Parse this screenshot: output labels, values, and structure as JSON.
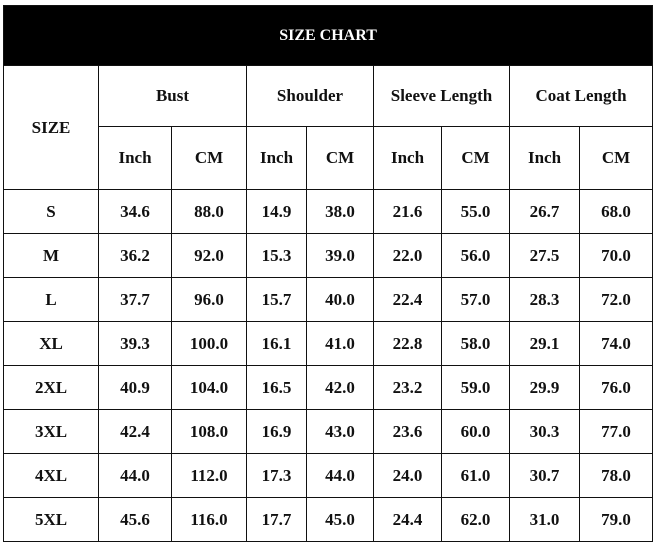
{
  "title": "SIZE CHART",
  "size_header": "SIZE",
  "groups": [
    "Bust",
    "Shoulder",
    "Sleeve Length",
    "Coat Length"
  ],
  "units": [
    "Inch",
    "CM"
  ],
  "rows": [
    [
      "S",
      "34.6",
      "88.0",
      "14.9",
      "38.0",
      "21.6",
      "55.0",
      "26.7",
      "68.0"
    ],
    [
      "M",
      "36.2",
      "92.0",
      "15.3",
      "39.0",
      "22.0",
      "56.0",
      "27.5",
      "70.0"
    ],
    [
      "L",
      "37.7",
      "96.0",
      "15.7",
      "40.0",
      "22.4",
      "57.0",
      "28.3",
      "72.0"
    ],
    [
      "XL",
      "39.3",
      "100.0",
      "16.1",
      "41.0",
      "22.8",
      "58.0",
      "29.1",
      "74.0"
    ],
    [
      "2XL",
      "40.9",
      "104.0",
      "16.5",
      "42.0",
      "23.2",
      "59.0",
      "29.9",
      "76.0"
    ],
    [
      "3XL",
      "42.4",
      "108.0",
      "16.9",
      "43.0",
      "23.6",
      "60.0",
      "30.3",
      "77.0"
    ],
    [
      "4XL",
      "44.0",
      "112.0",
      "17.3",
      "44.0",
      "24.0",
      "61.0",
      "30.7",
      "78.0"
    ],
    [
      "5XL",
      "45.6",
      "116.0",
      "17.7",
      "45.0",
      "24.4",
      "62.0",
      "31.0",
      "79.0"
    ]
  ]
}
